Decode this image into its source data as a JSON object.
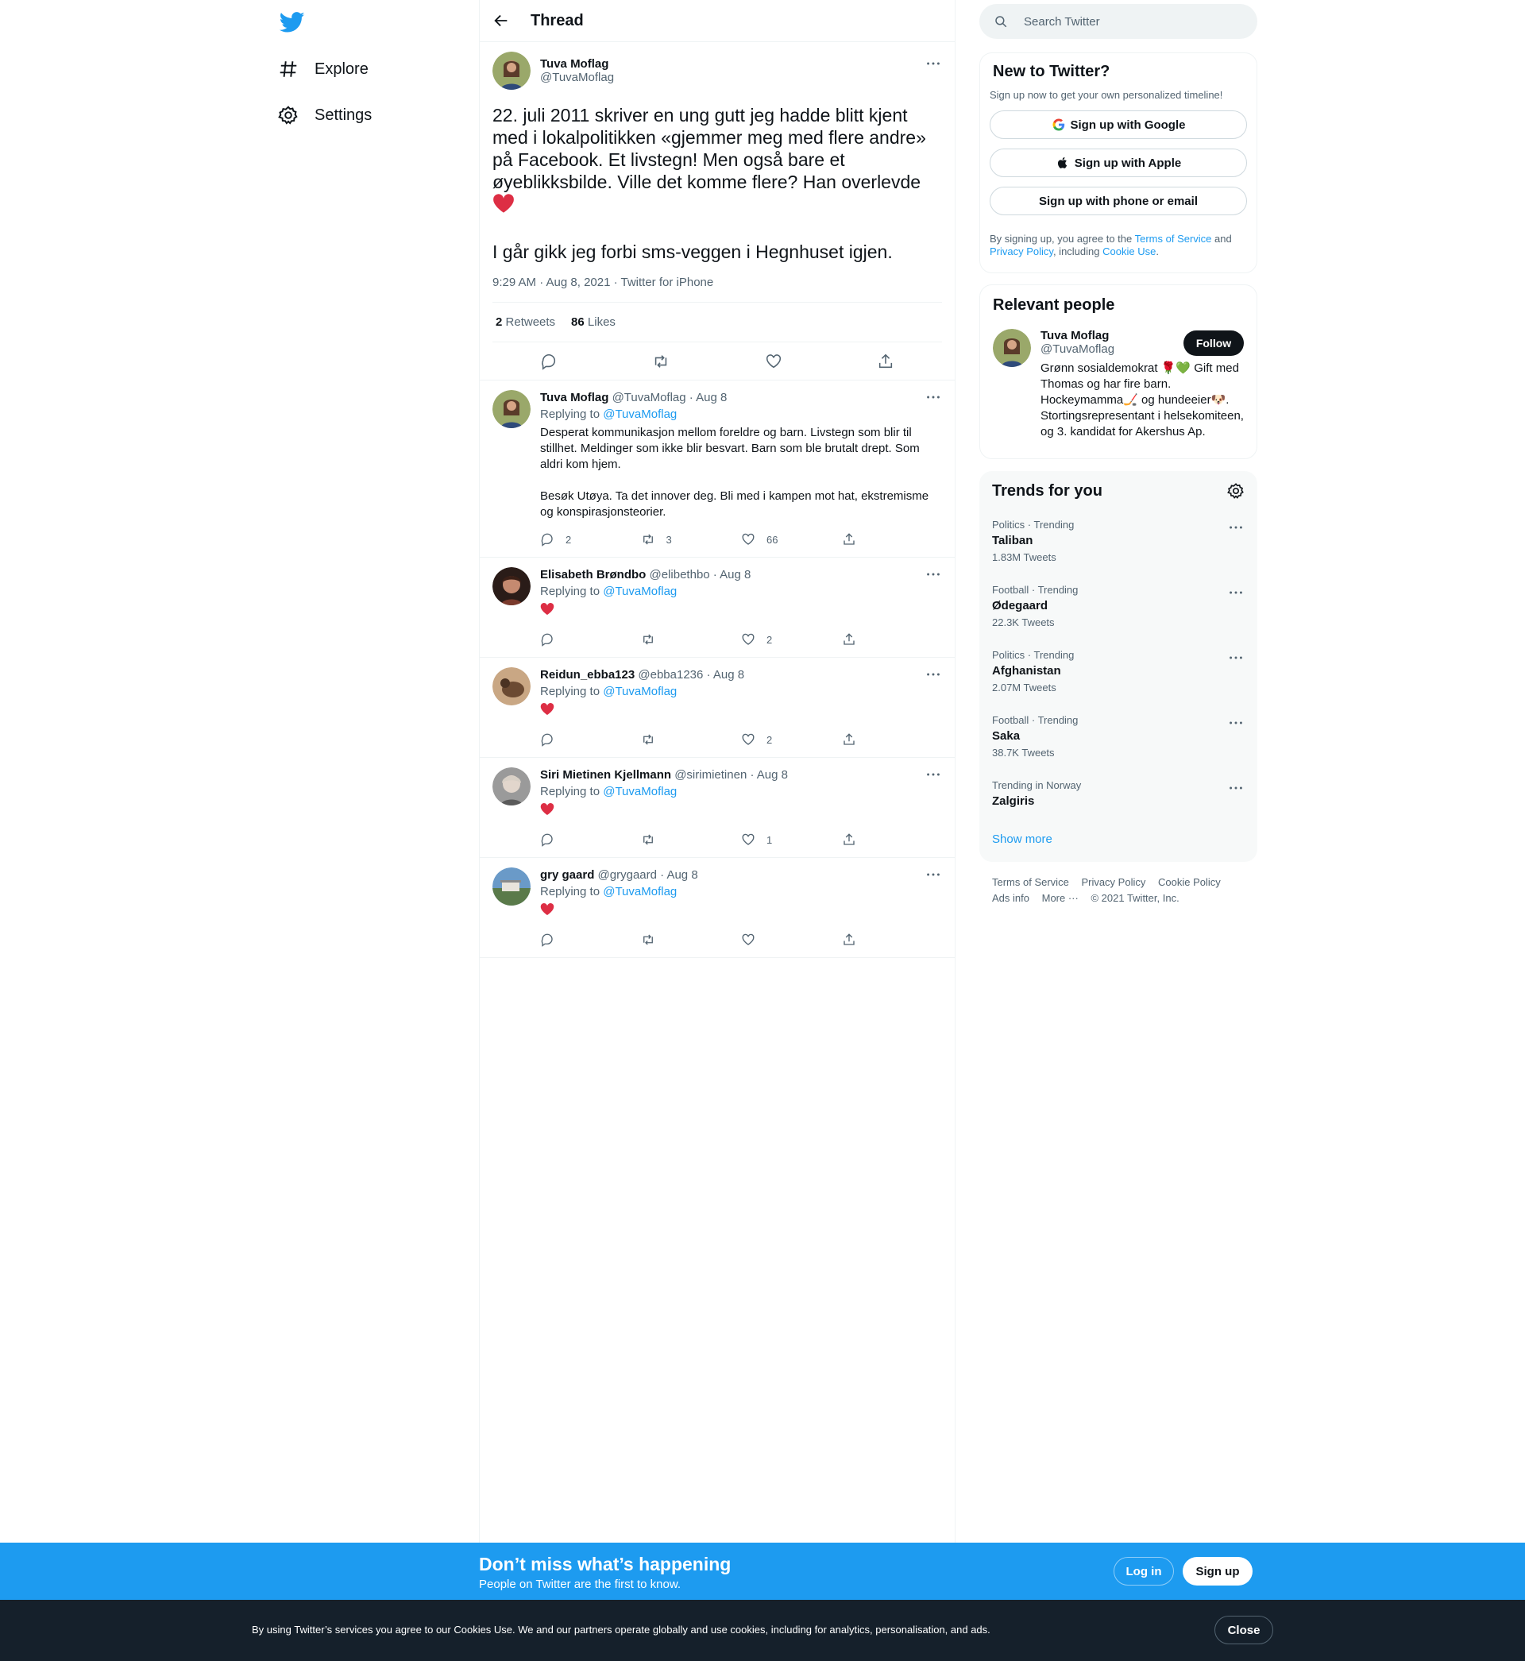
{
  "nav": {
    "logo": "twitter-bird-icon",
    "items": [
      {
        "label": "Explore",
        "icon": "hashtag-icon"
      },
      {
        "label": "Settings",
        "icon": "gear-icon"
      }
    ]
  },
  "thread": {
    "title": "Thread",
    "main": {
      "name": "Tuva Moflag",
      "handle": "@TuvaMoflag",
      "text_1": "22. juli 2011 skriver en ung gutt jeg hadde blitt kjent med i lokalpolitikken «gjemmer meg med flere andre» på Facebook. Et livstegn! Men også bare et øyeblikksbilde. Ville det komme flere? Han overlevde ",
      "text_2": "I går gikk jeg forbi sms-veggen i Hegnhuset igjen.",
      "meta": "9:29 AM · Aug 8, 2021 · Twitter for iPhone",
      "retweets": "2",
      "retweets_label": "Retweets",
      "likes": "86",
      "likes_label": "Likes"
    },
    "replying_label": "Replying to",
    "replies": [
      {
        "name": "Tuva Moflag",
        "sub": "@TuvaMoflag · Aug 8",
        "replying_to": "@TuvaMoflag",
        "body": "Desperat kommunikasjon mellom foreldre og barn. Livstegn som blir til stillhet. Meldinger som ikke blir besvart. Barn som ble brutalt drept. Som aldri kom hjem.\n\nBesøk Utøya. Ta det innover deg. Bli med i kampen mot hat, ekstremisme og konspirasjonsteorier.",
        "replies": "2",
        "retweets": "3",
        "likes": "66"
      },
      {
        "name": "Elisabeth Brøndbo",
        "sub": "@elibethbo · Aug 8",
        "replying_to": "@TuvaMoflag",
        "replies": "",
        "retweets": "",
        "likes": "2"
      },
      {
        "name": "Reidun_ebba123",
        "sub": "@ebba1236 · Aug 8",
        "replying_to": "@TuvaMoflag",
        "replies": "",
        "retweets": "",
        "likes": "2"
      },
      {
        "name": "Siri Mietinen Kjellmann",
        "sub": "@sirimietinen · Aug 8",
        "replying_to": "@TuvaMoflag",
        "replies": "",
        "retweets": "",
        "likes": "1"
      },
      {
        "name": "gry gaard",
        "sub": "@grygaard · Aug 8",
        "replying_to": "@TuvaMoflag",
        "replies": "",
        "retweets": "",
        "likes": ""
      }
    ]
  },
  "search": {
    "placeholder": "Search Twitter"
  },
  "new_to_twitter": {
    "title": "New to Twitter?",
    "subtitle": "Sign up now to get your own personalized timeline!",
    "google": "Sign up with Google",
    "apple": "Sign up with Apple",
    "phone": "Sign up with phone or email",
    "legal_1": "By signing up, you agree to the ",
    "tos": "Terms of Service",
    "legal_2": " and ",
    "privacy": "Privacy Policy",
    "legal_3": ", including ",
    "cookie": "Cookie Use",
    "legal_4": "."
  },
  "relevant_people": {
    "title": "Relevant people",
    "name": "Tuva Moflag",
    "handle": "@TuvaMoflag",
    "follow": "Follow",
    "bio": "Grønn sosialdemokrat 🌹💚 Gift med Thomas og har fire barn. Hockeymamma🏒 og hundeeier🐶. Stortingsrepresentant i helsekomiteen, og 3. kandidat for Akershus Ap."
  },
  "trends": {
    "title": "Trends for you",
    "items": [
      {
        "context": "Politics · Trending",
        "topic": "Taliban",
        "count": "1.83M Tweets"
      },
      {
        "context": "Football · Trending",
        "topic": "Ødegaard",
        "count": "22.3K Tweets"
      },
      {
        "context": "Politics · Trending",
        "topic": "Afghanistan",
        "count": "2.07M Tweets"
      },
      {
        "context": "Football · Trending",
        "topic": "Saka",
        "count": "38.7K Tweets"
      },
      {
        "context": "Trending in Norway",
        "topic": "Zalgiris",
        "count": ""
      }
    ],
    "show_more": "Show more"
  },
  "footer": {
    "links": [
      "Terms of Service",
      "Privacy Policy",
      "Cookie Policy",
      "Ads info",
      "More ···"
    ],
    "copyright": "© 2021 Twitter, Inc."
  },
  "promo": {
    "title": "Don’t miss what’s happening",
    "subtitle": "People on Twitter are the first to know.",
    "login": "Log in",
    "signup": "Sign up"
  },
  "cookie_bar": {
    "text": "By using Twitter’s services you agree to our Cookies Use. We and our partners operate globally and use cookies, including for analytics, personalisation, and ads.",
    "close": "Close"
  },
  "colors": {
    "accent": "#1d9bf0",
    "text": "#0f1419",
    "muted": "#536471",
    "cookie_bg": "#15202b",
    "heart": "#e0245e"
  }
}
